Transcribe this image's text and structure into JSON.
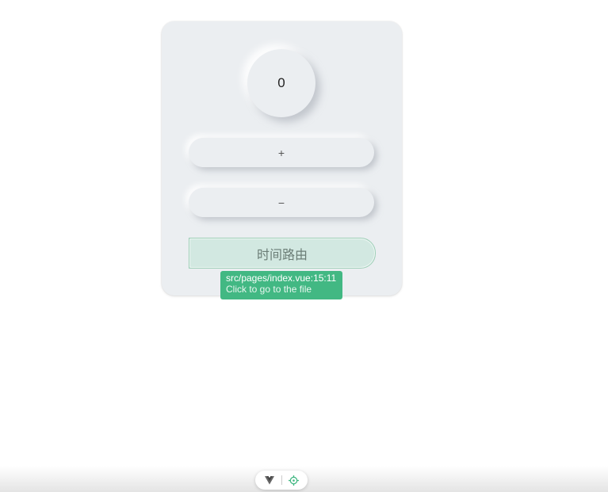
{
  "counter": {
    "value": "0"
  },
  "buttons": {
    "increment_label": "+",
    "decrement_label": "−",
    "route_label": "时间路由"
  },
  "tooltip": {
    "path": "src/pages/index.vue:15:11",
    "hint": "Click to go to the file"
  },
  "devtools": {
    "vue_icon": "vue-logo-icon",
    "inspect_icon": "crosshair-icon",
    "accent_color": "#42b883"
  },
  "colors": {
    "card_background": "#ebeef1",
    "route_button_background": "#d2e8e1",
    "tooltip_background": "#42b883"
  }
}
